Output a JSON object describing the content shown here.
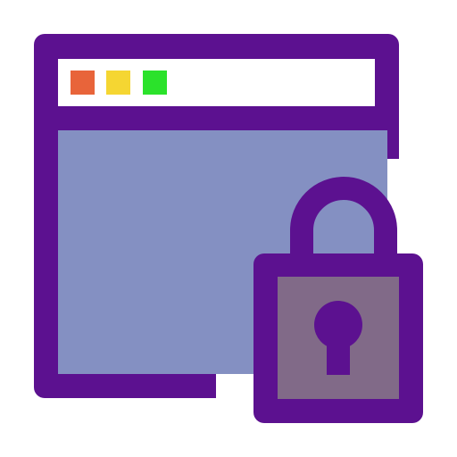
{
  "icon": {
    "name": "secure-browser-window-icon",
    "parts": {
      "window": "browser-window-icon",
      "lock": "padlock-icon",
      "keyhole": "keyhole-icon"
    },
    "window_buttons": [
      {
        "name": "close-dot",
        "color": "#E8643A"
      },
      {
        "name": "minimize-dot",
        "color": "#F5D632"
      },
      {
        "name": "maximize-dot",
        "color": "#2BE22B"
      }
    ],
    "colors": {
      "outline": "#5C1190",
      "title_bar": "#FFFFFF",
      "content": "#8490C2",
      "lock_body": "#816A88",
      "background": "#FFFFFF"
    }
  }
}
